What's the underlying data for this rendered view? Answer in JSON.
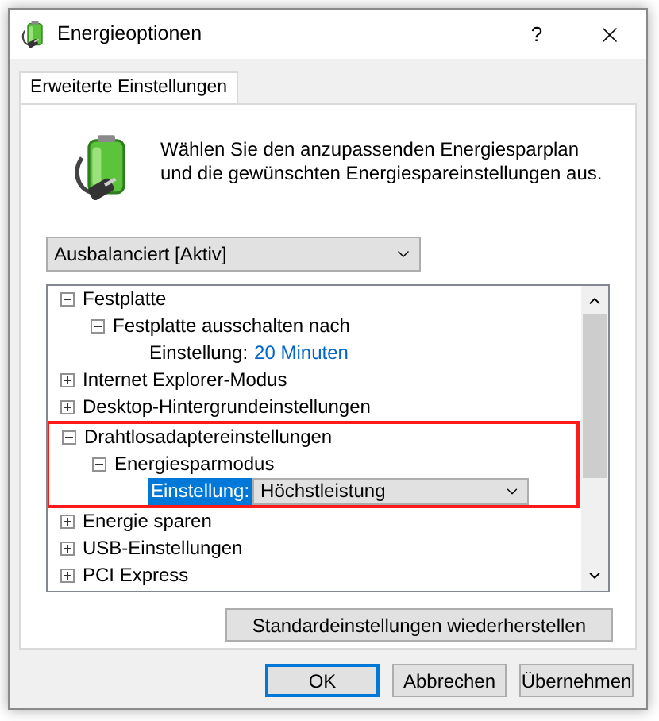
{
  "window": {
    "title": "Energieoptionen",
    "help": "?"
  },
  "tabs": [
    {
      "label": "Erweiterte Einstellungen",
      "selected": true
    }
  ],
  "description": "Wählen Sie den anzupassenden Energiesparplan und die gewünschten Energiespareinstellungen aus.",
  "plan_select": {
    "value": "Ausbalanciert [Aktiv]"
  },
  "tree": [
    {
      "label": "Festplatte",
      "expanded": true,
      "highlighted": false,
      "children": [
        {
          "label": "Festplatte ausschalten nach",
          "expanded": true,
          "children": [
            {
              "kind": "value",
              "label": "Einstellung:",
              "value": "20 Minuten",
              "selected": false
            }
          ]
        }
      ]
    },
    {
      "label": "Internet Explorer-Modus",
      "expanded": false,
      "highlighted": false
    },
    {
      "label": "Desktop-Hintergrundeinstellungen",
      "expanded": false,
      "highlighted": false
    },
    {
      "label": "Drahtlosadaptereinstellungen",
      "expanded": true,
      "highlighted": true,
      "children": [
        {
          "label": "Energiesparmodus",
          "expanded": true,
          "children": [
            {
              "kind": "dropdown",
              "label": "Einstellung:",
              "value": "Höchstleistung",
              "selected": true
            }
          ]
        }
      ]
    },
    {
      "label": "Energie sparen",
      "expanded": false,
      "highlighted": false
    },
    {
      "label": "USB-Einstellungen",
      "expanded": false,
      "highlighted": false
    },
    {
      "label": "PCI Express",
      "expanded": false,
      "highlighted": false
    }
  ],
  "restore_button": "Standardeinstellungen wiederherstellen",
  "buttons": [
    {
      "label": "OK",
      "default": true
    },
    {
      "label": "Abbrechen",
      "default": false
    },
    {
      "label": "Übernehmen",
      "default": false
    }
  ]
}
